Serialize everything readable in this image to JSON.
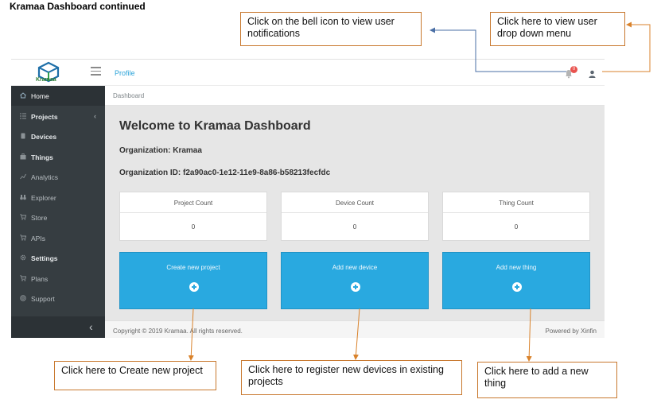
{
  "doc_title": "Kramaa Dashboard continued",
  "callouts": {
    "bell": "Click on the bell icon to view user notifications",
    "user": "Click here to view user drop down menu",
    "project": "Click here to Create new project",
    "device": "Click here to register new devices in existing projects",
    "thing": "Click here to add a new thing"
  },
  "topbar": {
    "logo_text": "Kramaa",
    "profile_link": "Profile",
    "bell_badge": "0"
  },
  "sidebar": {
    "items": [
      {
        "label": "Home",
        "icon": "home-icon"
      },
      {
        "label": "Projects",
        "icon": "list-icon"
      },
      {
        "label": "Devices",
        "icon": "device-icon"
      },
      {
        "label": "Things",
        "icon": "briefcase-icon"
      },
      {
        "label": "Analytics",
        "icon": "chart-icon"
      },
      {
        "label": "Explorer",
        "icon": "binoculars-icon"
      },
      {
        "label": "Store",
        "icon": "cart-icon"
      },
      {
        "label": "APIs",
        "icon": "cart-icon"
      },
      {
        "label": "Settings",
        "icon": "gear-icon"
      },
      {
        "label": "Plans",
        "icon": "cart-icon"
      },
      {
        "label": "Support",
        "icon": "lifebuoy-icon"
      }
    ]
  },
  "breadcrumb": "Dashboard",
  "main": {
    "welcome": "Welcome to Kramaa Dashboard",
    "organization": "Organization: Kramaa",
    "organization_id": "Organization ID: f2a90ac0-1e12-11e9-8a86-b58213fecfdc"
  },
  "stats": [
    {
      "label": "Project Count",
      "value": "0"
    },
    {
      "label": "Device Count",
      "value": "0"
    },
    {
      "label": "Thing Count",
      "value": "0"
    }
  ],
  "actions": [
    {
      "label": "Create new project"
    },
    {
      "label": "Add new device"
    },
    {
      "label": "Add new thing"
    }
  ],
  "footer": {
    "copyright": "Copyright © 2019 Kramaa. All rights reserved.",
    "powered": "Powered by Xinfin"
  },
  "colors": {
    "accent": "#29a9e0",
    "sidebar": "#363d41",
    "callout_border": "#c8782e",
    "badge": "#e9534f"
  }
}
